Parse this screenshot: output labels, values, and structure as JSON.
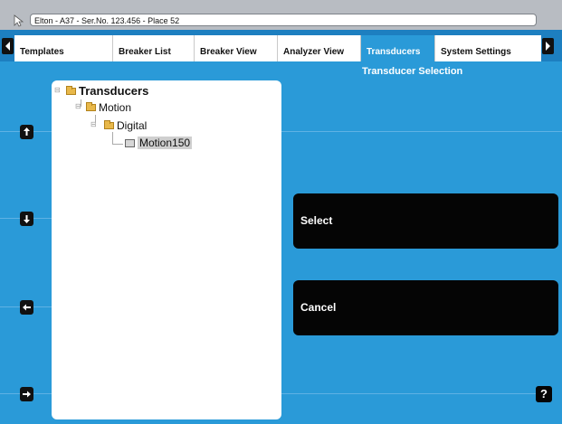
{
  "window": {
    "title": "Elton - A37 - Ser.No. 123.456 - Place 52"
  },
  "tabs": [
    {
      "label": "Templates",
      "active": false
    },
    {
      "label": "Breaker List",
      "active": false
    },
    {
      "label": "Breaker View",
      "active": false
    },
    {
      "label": "Analyzer View",
      "active": false
    },
    {
      "label": "Transducers",
      "active": true
    },
    {
      "label": "System Settings",
      "active": false
    }
  ],
  "section_title": "Transducer Selection",
  "tree": {
    "root": "Transducers",
    "level1": "Motion",
    "level2": "Digital",
    "leaf": "Motion150"
  },
  "buttons": {
    "select": "Select",
    "cancel": "Cancel",
    "help": "?"
  },
  "colors": {
    "background": "#2a9ad8",
    "active_tab": "#2a9ad8",
    "button": "#050505"
  },
  "icons": [
    "cursor-icon",
    "tab-scroll-left-icon",
    "tab-scroll-right-icon",
    "folder-icon",
    "sensor-icon",
    "arrow-up-icon",
    "arrow-down-icon",
    "arrow-left-icon",
    "arrow-right-icon",
    "help-icon"
  ]
}
